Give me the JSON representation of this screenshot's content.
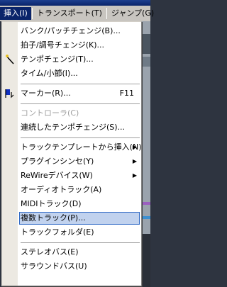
{
  "menubar": {
    "items": [
      {
        "label": "挿入(I)",
        "active": true
      },
      {
        "label": "トランスポート(T)",
        "active": false
      },
      {
        "label": "ジャンプ(G)",
        "active": false
      }
    ]
  },
  "menu": {
    "bank_patch": "バンク/パッチチェンジ(B)...",
    "time_sig": "拍子/調号チェンジ(K)...",
    "tempo_change": "テンポチェンジ(T)...",
    "time_measure": "タイム/小節(I)...",
    "marker": "マーカー(R)...",
    "marker_shortcut": "F11",
    "controller": "コントローラ(C)",
    "continuous_tempo": "連続したテンポチェンジ(S)...",
    "insert_track_template": "トラックテンプレートから挿入(N)",
    "plugin_synth": "プラグインシンセ(Y)",
    "rewire_device": "ReWireデバイス(W)",
    "audio_track": "オーディオトラック(A)",
    "midi_track": "MIDIトラック(D)",
    "multiple_tracks": "複数トラック(P)...",
    "track_folder": "トラックフォルダ(E)",
    "stereo_bus": "ステレオバス(E)",
    "surround_bus": "サラウンドバス(U)"
  },
  "colors": {
    "highlight_fill": "#c1d2ee",
    "highlight_border": "#316ac5",
    "menubar_active": "#0a246a"
  }
}
